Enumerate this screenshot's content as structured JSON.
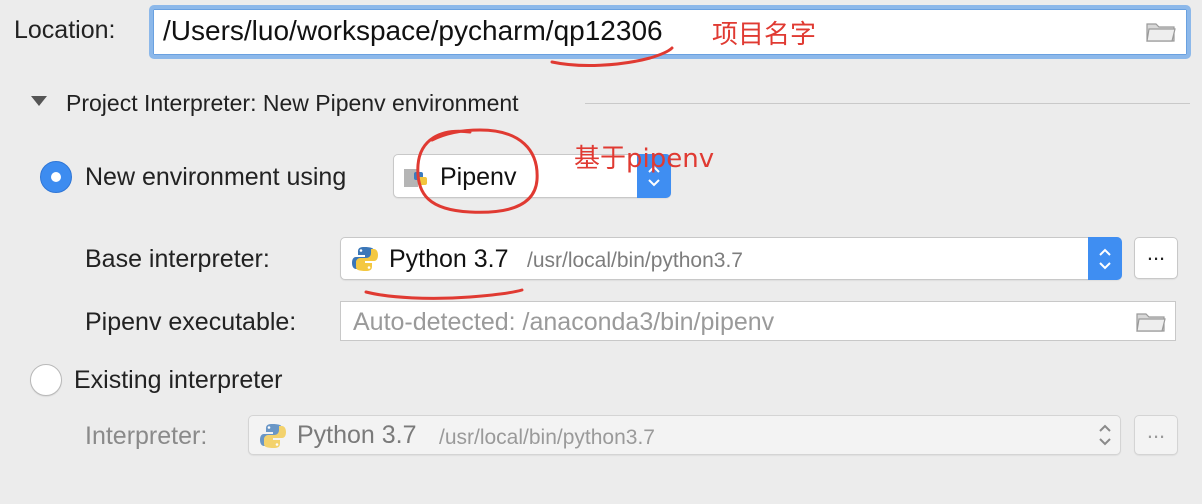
{
  "location": {
    "label": "Location:",
    "value": "/Users/luo/workspace/pycharm/qp12306",
    "annotation": "项目名字"
  },
  "section": {
    "title": "Project Interpreter: New Pipenv environment"
  },
  "new_env": {
    "radio_label": "New environment using",
    "selected": true,
    "tool": "Pipenv",
    "annotation": "基于pipenv"
  },
  "base_interpreter": {
    "label": "Base interpreter:",
    "name": "Python 3.7",
    "path": "/usr/local/bin/python3.7",
    "browse_label": "..."
  },
  "pipenv_executable": {
    "label": "Pipenv executable:",
    "placeholder": "Auto-detected: /anaconda3/bin/pipenv"
  },
  "existing": {
    "radio_label": "Existing interpreter",
    "selected": false
  },
  "interpreter": {
    "label": "Interpreter:",
    "name": "Python 3.7",
    "path": "/usr/local/bin/python3.7",
    "browse_label": "..."
  },
  "colors": {
    "accent": "#3f8ef2",
    "annotation": "#e03a32",
    "background": "#ececec"
  },
  "icons": [
    "folder-icon",
    "python-icon",
    "pipenv-icon",
    "disclosure-triangle-icon",
    "stepper-icon"
  ]
}
